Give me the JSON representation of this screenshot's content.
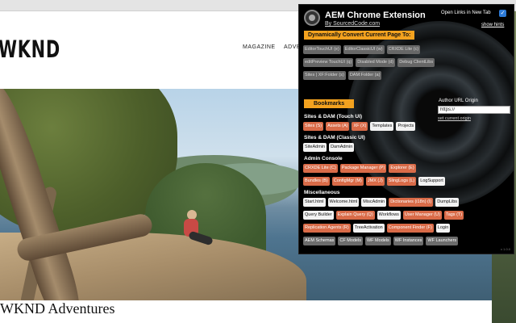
{
  "site": {
    "logo": "WKND",
    "nav": {
      "magazine": "MAGAZINE",
      "adventures": "ADVE"
    },
    "article_title": "WKND Adventures"
  },
  "popup": {
    "title": "AEM Chrome Extension",
    "byline": "By SourcedCode.com",
    "open_links_label": "Open Links in New Tab",
    "open_links_checked": "✓",
    "show_hints": "show hints",
    "convert_heading": "Dynamically Convert Current Page To:",
    "convert_row1": [
      "EditorTouchUI (e)",
      "EditorClassicUI (w)",
      "CRXDE Lite (c)"
    ],
    "convert_row2": [
      "editPreview TouchUI (q)",
      "Disabled Mode (d)",
      "Debug ClientLibs"
    ],
    "convert_row3": [
      "Sites | XF:Folder (s)",
      "DAM:Folder (a)"
    ],
    "bookmarks_heading": "Bookmarks",
    "author_url_label": "Author URL Origin",
    "author_url_value": "https://",
    "set_current_origin": "set current origin",
    "sites_touch_heading": "Sites & DAM (Touch UI)",
    "sites_touch": [
      "Sites (S)",
      "Assets (A)",
      "XF (X)",
      "Templates",
      "Projects"
    ],
    "sites_classic_heading": "Sites & DAM (Classic UI)",
    "sites_classic": [
      "SiteAdmin",
      "DamAdmin"
    ],
    "admin_heading": "Admin Console",
    "admin_row1": [
      "CRXDE Lite (C)",
      "Package Manager (P)",
      "Explorer (E)"
    ],
    "admin_row2": [
      "Bundles (B)",
      "ConfigMgr (M)",
      "JMX (J)",
      "SlingLogs (L)",
      "LogSupport"
    ],
    "misc_heading": "Miscellaneous",
    "misc_row1": [
      "Start.html",
      "Welcome.html",
      "MiscAdmin",
      "Dictionaries (i18n) (I)",
      "DumpLibs"
    ],
    "misc_row2": [
      "Query Builder",
      "Explain Query (Q)",
      "Workflows",
      "User Manager (U)",
      "Tags (T)"
    ],
    "misc_row3": [
      "Replication Agents (R)",
      "TreeActivation",
      "Component Finder (F)",
      "Login"
    ],
    "misc_row4": [
      "AEM Schemas",
      "CF Models",
      "WF Models",
      "WF Instances",
      "WF Launchers"
    ],
    "version": "v 1.0.0"
  },
  "colors": {
    "accent_orange": "#f3a21f",
    "button_orange": "#d96b48",
    "popup_bg": "#000000"
  }
}
